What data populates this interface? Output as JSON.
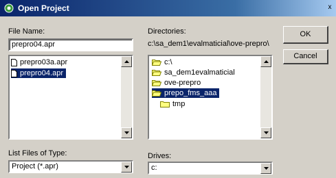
{
  "window": {
    "title": "Open Project",
    "close_glyph": "x"
  },
  "file_name": {
    "label": "File Name:",
    "value": "prepro04.apr"
  },
  "files": [
    {
      "name": "prepro03a.apr",
      "selected": false
    },
    {
      "name": "prepro04.apr",
      "selected": true
    }
  ],
  "directories": {
    "label": "Directories:",
    "path": "c:\\sa_dem1\\evalmaticial\\ove-prepro\\",
    "items": [
      {
        "name": "c:\\",
        "state": "open",
        "selected": false
      },
      {
        "name": "sa_dem1evalmaticial",
        "state": "open",
        "selected": false
      },
      {
        "name": "ove-prepro",
        "state": "open",
        "selected": false
      },
      {
        "name": "prepo_fms_aaa",
        "state": "open",
        "selected": true
      },
      {
        "name": "tmp",
        "state": "closed",
        "selected": false
      }
    ]
  },
  "buttons": {
    "ok": "OK",
    "cancel": "Cancel"
  },
  "file_type": {
    "label": "List Files of Type:",
    "value": "Project (*.apr)"
  },
  "drives": {
    "label": "Drives:",
    "value": "c:"
  },
  "colors": {
    "title_bar": "#0a246a",
    "selection": "#0a246a",
    "dialog_bg": "#d4d0c8"
  }
}
